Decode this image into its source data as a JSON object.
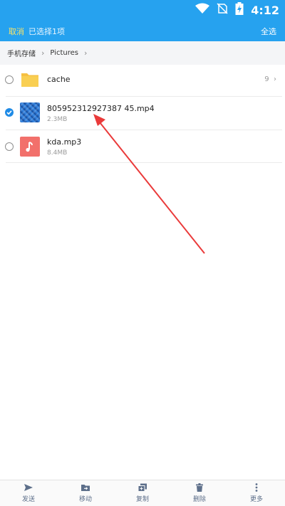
{
  "status": {
    "time": "4:12"
  },
  "header": {
    "cancel_label": "取消",
    "selected_label": "已选择1项",
    "select_all_label": "全选"
  },
  "breadcrumb": {
    "items": [
      "手机存储",
      "Pictures"
    ]
  },
  "files": [
    {
      "name": "cache",
      "count": "9",
      "selected": false,
      "kind": "folder"
    },
    {
      "name": "805952312927387 45.mp4",
      "size": "2.3MB",
      "selected": true,
      "kind": "video"
    },
    {
      "name": "kda.mp3",
      "size": "8.4MB",
      "selected": false,
      "kind": "audio"
    }
  ],
  "toolbar": {
    "send": "发送",
    "move": "移动",
    "copy": "复制",
    "delete": "删除",
    "more": "更多"
  },
  "colors": {
    "accent": "#26a2ef",
    "cancel": "#f7e36a",
    "folder": "#f6c042",
    "audio": "#f2706b",
    "check": "#1f8be6"
  },
  "icons": [
    "wifi-icon",
    "no-sim-icon",
    "battery-icon",
    "folder-icon",
    "music-note-icon",
    "send-icon",
    "move-folder-icon",
    "copy-icon",
    "trash-icon",
    "more-dots-icon"
  ]
}
